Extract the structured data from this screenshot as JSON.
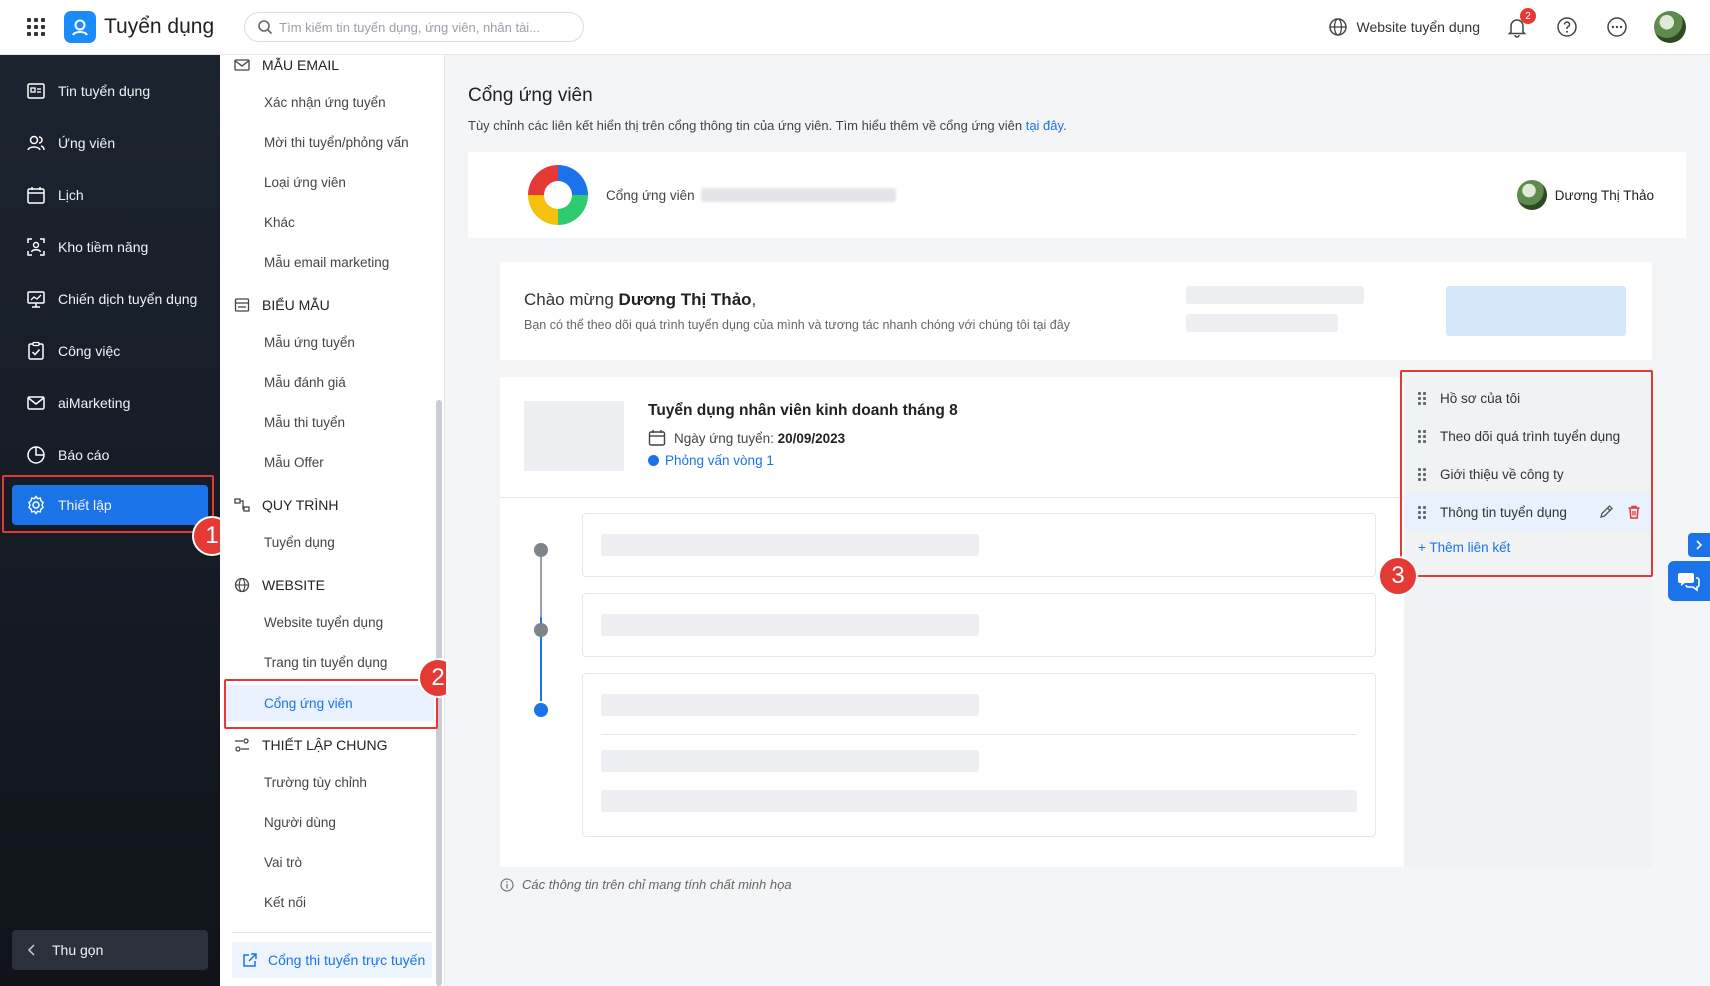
{
  "topbar": {
    "brand": "Tuyển dụng",
    "search_placeholder": "Tìm kiếm tin tuyển dụng, ứng viên, nhân tài...",
    "website_link": "Website tuyển dụng",
    "notification_count": "2"
  },
  "sidebar": {
    "items": [
      {
        "label": "Tin tuyển dụng",
        "icon": "job-post-icon"
      },
      {
        "label": "Ứng viên",
        "icon": "candidates-icon"
      },
      {
        "label": "Lịch",
        "icon": "calendar-icon"
      },
      {
        "label": "Kho tiềm năng",
        "icon": "talent-pool-icon"
      },
      {
        "label": "Chiến dịch tuyển dụng",
        "icon": "campaign-icon"
      },
      {
        "label": "Công việc",
        "icon": "task-icon"
      },
      {
        "label": "aiMarketing",
        "icon": "mail-icon"
      },
      {
        "label": "Báo cáo",
        "icon": "report-icon"
      },
      {
        "label": "Thiết lập",
        "icon": "gear-icon",
        "active": true
      }
    ],
    "collapse_label": "Thu gọn"
  },
  "steps": [
    "1",
    "2",
    "3"
  ],
  "settings_menu": {
    "email_section": "MẪU EMAIL",
    "email_items": [
      "Xác nhận ứng tuyển",
      "Mời thi tuyển/phỏng vấn",
      "Loại ứng viên",
      "Khác",
      "Mẫu email marketing"
    ],
    "form_section": "BIỂU MẪU",
    "form_items": [
      "Mẫu ứng tuyển",
      "Mẫu đánh giá",
      "Mẫu thi tuyển",
      "Mẫu Offer"
    ],
    "process_section": "QUY TRÌNH",
    "process_items": [
      "Tuyển dụng"
    ],
    "website_section": "WEBSITE",
    "website_items": [
      "Website tuyển dụng",
      "Trang tin tuyển dụng",
      "Cổng ứng viên"
    ],
    "general_section": "THIẾT LẬP CHUNG",
    "general_items": [
      "Trường tùy chỉnh",
      "Người dùng",
      "Vai trò",
      "Kết nối"
    ],
    "online_link": "Cổng thi tuyển trực tuyến"
  },
  "main": {
    "title": "Cổng ứng viên",
    "description": "Tùy chỉnh các liên kết hiển thị trên cổng thông tin của ứng viên. Tìm hiểu thêm về cổng ứng viên ",
    "description_link": "tại đây",
    "description_end": ".",
    "portal_label": "Cổng ứng viên",
    "portal_user": "Dương Thị Thảo",
    "welcome_prefix": "Chào mừng ",
    "welcome_name": "Dương Thị Thảo",
    "welcome_suffix": ",",
    "welcome_sub": "Bạn có thể theo dõi quá trình tuyển dụng của mình và tương tác nhanh chóng với chúng tôi tại đây",
    "job_title": "Tuyển dụng nhân viên kinh doanh tháng 8",
    "apply_date_label": "Ngày ứng tuyển: ",
    "apply_date": "20/09/2023",
    "job_stage": "Phỏng vấn vòng 1",
    "links": [
      "Hồ sơ của tôi",
      "Theo dõi quá trình tuyển dụng",
      "Giới thiệu về công ty",
      "Thông tin tuyển dụng"
    ],
    "add_link": "+ Thêm liên kết",
    "disclaimer": "Các thông tin trên chỉ mang tính chất minh họa"
  },
  "colors": {
    "accent": "#1a73e8",
    "highlight": "#e53935"
  }
}
